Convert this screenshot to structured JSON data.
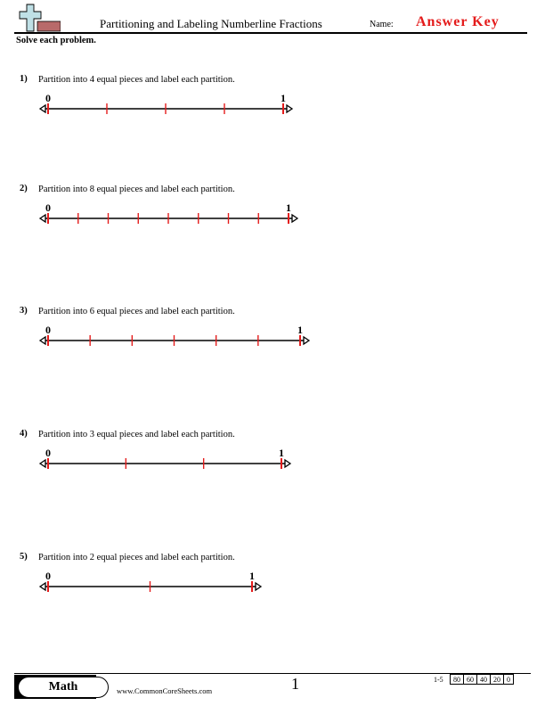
{
  "header": {
    "logo_icon": "plus-cross-logo-icon",
    "title": "Partitioning and Labeling Numberline Fractions",
    "name_label": "Name:",
    "name_value": "Answer Key",
    "answer_color": "#e41b1b"
  },
  "instructions": "Solve each problem.",
  "problems": [
    {
      "number": "1)",
      "prompt": "Partition into 4 equal pieces and label each partition.",
      "partitions": 4,
      "start_label": "0",
      "end_label": "1"
    },
    {
      "number": "2)",
      "prompt": "Partition into 8 equal pieces and label each partition.",
      "partitions": 8,
      "start_label": "0",
      "end_label": "1"
    },
    {
      "number": "3)",
      "prompt": "Partition into 6 equal pieces and label each partition.",
      "partitions": 6,
      "start_label": "0",
      "end_label": "1"
    },
    {
      "number": "4)",
      "prompt": "Partition into 3 equal pieces and label each partition.",
      "partitions": 3,
      "start_label": "0",
      "end_label": "1"
    },
    {
      "number": "5)",
      "prompt": "Partition into 2 equal pieces and label each partition.",
      "partitions": 2,
      "start_label": "0",
      "end_label": "1"
    }
  ],
  "colors": {
    "tick": "#e41b1b",
    "line": "#000000",
    "logo_cross": "#bfe0e6",
    "logo_bar": "#b86a6a"
  },
  "footer": {
    "subject": "Math",
    "site": "www.CommonCoreSheets.com",
    "page": "1",
    "score_range": "1-5",
    "scores": [
      "80",
      "60",
      "40",
      "20",
      "0"
    ]
  }
}
